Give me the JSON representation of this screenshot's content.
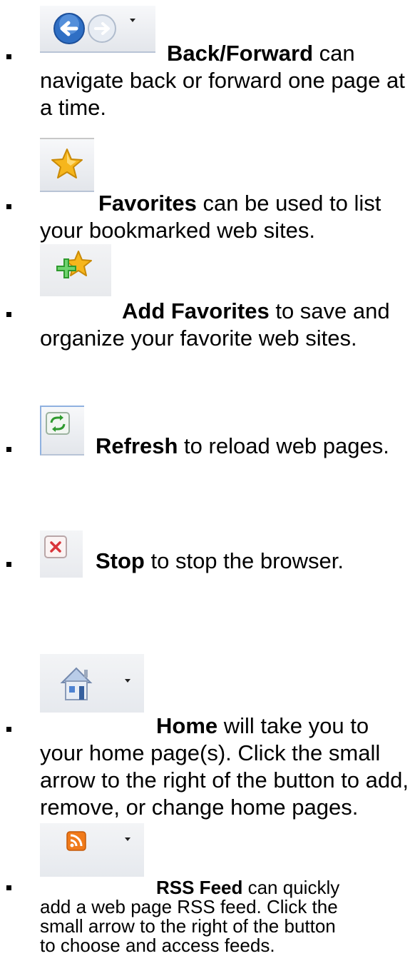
{
  "items": [
    {
      "icon": "back-forward-icon",
      "title": "Back/Forward",
      "rest_first": " can",
      "lines": [
        "navigate back or forward one page at",
        "a time."
      ]
    },
    {
      "icon": "favorites-star-icon",
      "title": "Favorites",
      "rest_first": " can be used to list",
      "lines": [
        "your bookmarked web sites."
      ]
    },
    {
      "icon": "add-favorites-icon",
      "title": "Add Favorites",
      "rest_first": " to save and",
      "lines": [
        "organize your favorite web sites."
      ]
    },
    {
      "icon": "refresh-icon",
      "title": "Refresh",
      "rest_first": " to reload web pages.",
      "lines": []
    },
    {
      "icon": "stop-icon",
      "title": "Stop",
      "rest_first": " to stop the browser.",
      "lines": []
    },
    {
      "icon": "home-icon",
      "title": "Home",
      "rest_first": " will take you to",
      "lines": [
        "your home page(s).  Click the small",
        "arrow to the right of the button to add,",
        "remove, or change home pages."
      ]
    },
    {
      "icon": "rss-feed-icon",
      "title": "RSS Feed",
      "rest_first": " can quickly",
      "lines": [
        "add a web page RSS feed.  Click the",
        "small arrow to the right of the button",
        "to choose and access feeds."
      ]
    }
  ],
  "colors": {
    "back_blue": "#2f6fc4",
    "star_gold": "#f6b61c",
    "add_green": "#2e9a2e",
    "stop_red": "#d9343a",
    "rss_orange": "#f07a1a"
  }
}
